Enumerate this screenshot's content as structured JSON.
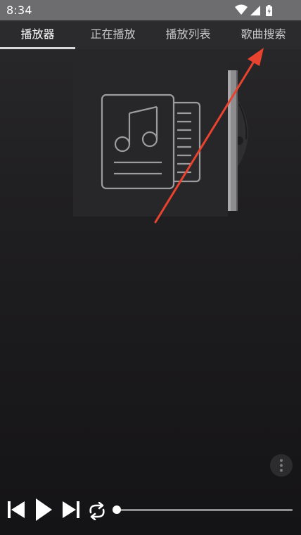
{
  "status_bar": {
    "time": "8:34",
    "icons": [
      "wifi-icon",
      "signal-icon",
      "battery-charging-icon"
    ]
  },
  "tabs": [
    {
      "label": "播放器",
      "active": true
    },
    {
      "label": "正在播放",
      "active": false
    },
    {
      "label": "播放列表",
      "active": false
    },
    {
      "label": "歌曲搜索",
      "active": false
    }
  ],
  "album_art": {
    "icon": "music-file-icon"
  },
  "annotation": {
    "type": "arrow",
    "color": "#e8432f",
    "points_to": "tab-song-search"
  },
  "player": {
    "controls": [
      "previous-icon",
      "play-icon",
      "next-icon",
      "repeat-icon"
    ],
    "progress": 0
  },
  "menu": {
    "icon": "more-vertical-icon"
  },
  "colors": {
    "accent": "#ffffff",
    "arrow": "#e8432f",
    "status_bar": "#6d6d6f",
    "background": "#1b1a1c"
  }
}
